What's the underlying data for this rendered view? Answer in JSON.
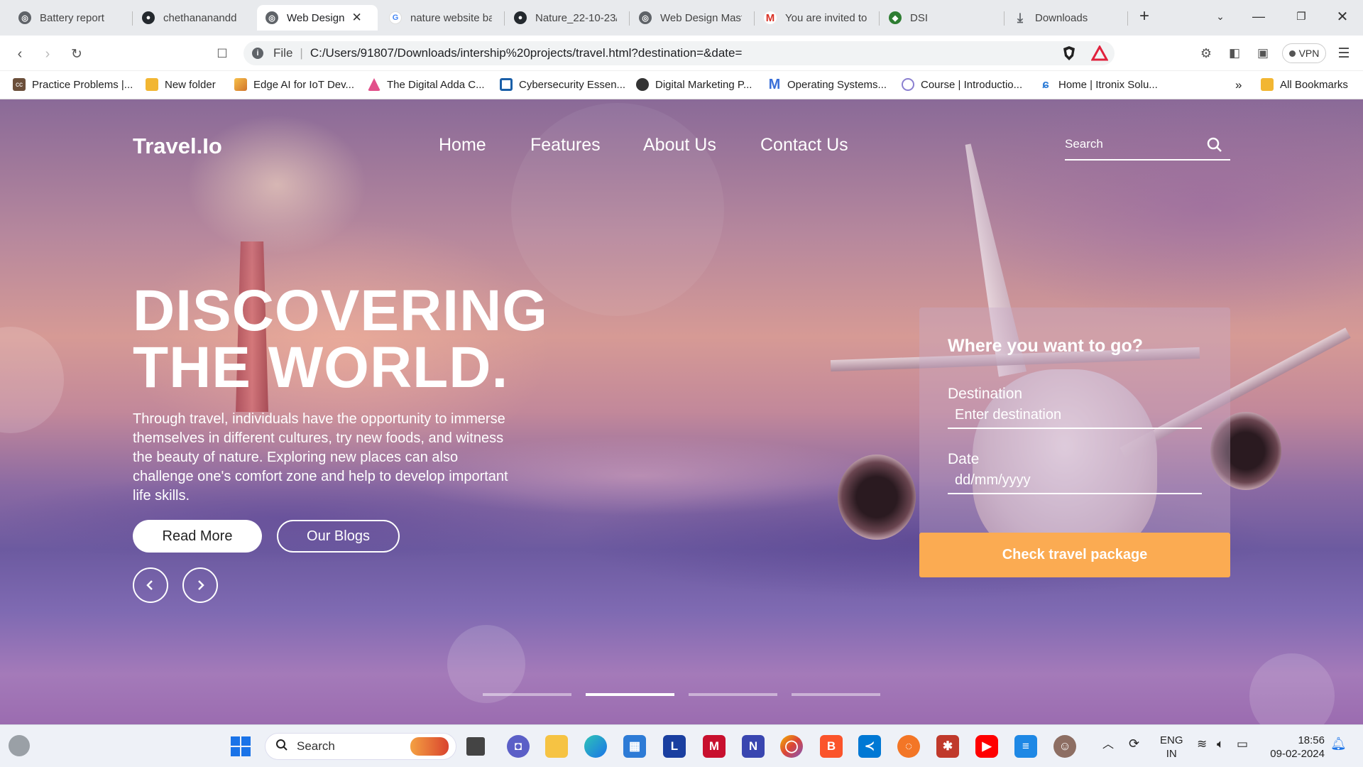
{
  "browser": {
    "tabs": [
      {
        "title": "Battery report",
        "icon": "globe-icon"
      },
      {
        "title": "chethananandd",
        "icon": "github-icon"
      },
      {
        "title": "Web Design",
        "icon": "globe-icon",
        "active": true
      },
      {
        "title": "nature website ba",
        "icon": "google-icon"
      },
      {
        "title": "Nature_22-10-23/",
        "icon": "github-icon"
      },
      {
        "title": "Web Design Mast",
        "icon": "globe-icon"
      },
      {
        "title": "You are invited to",
        "icon": "gmail-icon"
      },
      {
        "title": "DSI",
        "icon": "dsi-icon"
      },
      {
        "title": "Downloads",
        "icon": "download-icon"
      }
    ],
    "new_tab": "+",
    "address": {
      "scheme_label": "File",
      "url": "C:/Users/91807/Downloads/intership%20projects/travel.html?destination=&date="
    },
    "vpn_label": "VPN",
    "bookmarks": [
      {
        "label": "Practice Problems |...",
        "color": "#6b4f3a"
      },
      {
        "label": "New folder",
        "color": "#f2b632"
      },
      {
        "label": "Edge AI for IoT Dev...",
        "color": "#e8a33d"
      },
      {
        "label": "The Digital Adda C...",
        "color": "#e2508a"
      },
      {
        "label": "Cybersecurity Essen...",
        "color": "#1a5fa8"
      },
      {
        "label": "Digital Marketing P...",
        "color": "#333333"
      },
      {
        "label": "Operating Systems...",
        "color": "#3a6fd8"
      },
      {
        "label": "Course | Introductio...",
        "color": "#8a7fd0"
      },
      {
        "label": "Home | Itronix Solu...",
        "color": "#2b7bd6"
      }
    ],
    "bookmarks_overflow": "»",
    "all_bookmarks": "All Bookmarks"
  },
  "site": {
    "logo": "Travel.Io",
    "nav": [
      "Home",
      "Features",
      "About Us",
      "Contact Us"
    ],
    "search_placeholder": "Search",
    "headline_line1": "DISCOVERING",
    "headline_line2": "THE WORLD.",
    "description": "Through travel, individuals have the opportunity to immerse themselves in different cultures, try new foods, and witness the beauty of nature. Exploring new places can also challenge one's comfort zone and help to develop important life skills.",
    "read_more": "Read More",
    "our_blogs": "Our Blogs",
    "form": {
      "heading": "Where you want to go?",
      "destination_label": "Destination",
      "destination_placeholder": "Enter destination",
      "date_label": "Date",
      "date_placeholder": "dd/mm/yyyy",
      "submit": "Check travel package"
    },
    "slider": {
      "count": 4,
      "active_index": 1
    },
    "accent": "#fbab52"
  },
  "taskbar": {
    "search_placeholder": "Search",
    "language": "ENG",
    "region": "IN",
    "time": "18:56",
    "date": "09-02-2024"
  }
}
